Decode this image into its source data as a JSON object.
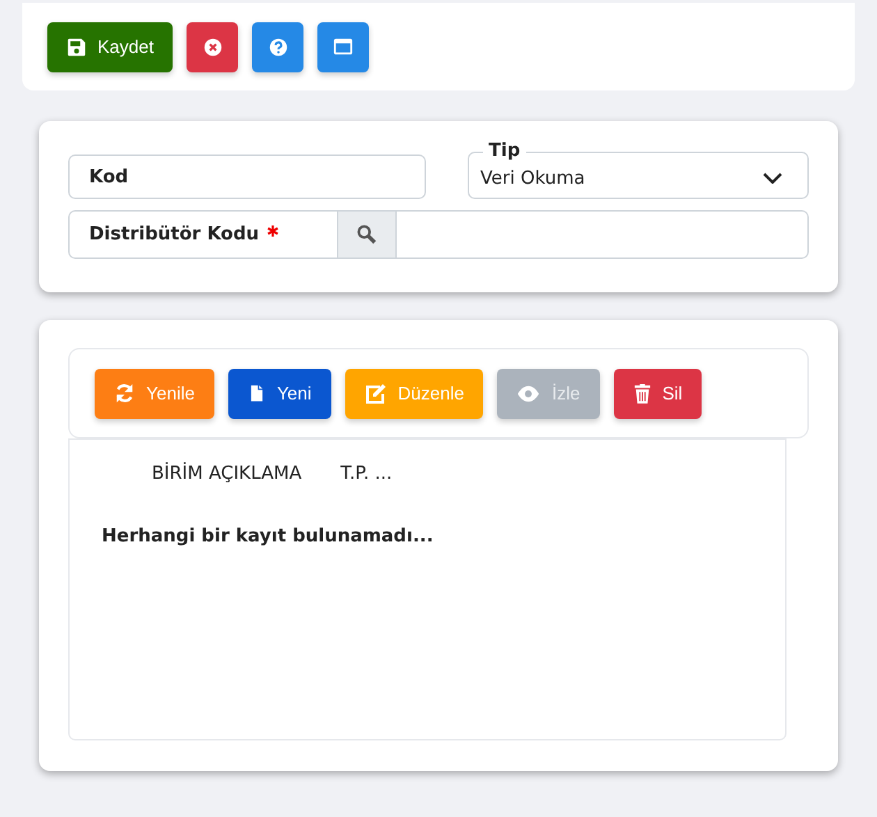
{
  "top_toolbar": [
    {
      "kind": "save",
      "label": "Kaydet",
      "color": "#267300"
    },
    {
      "kind": "close",
      "color": "#dc3545"
    },
    {
      "kind": "help",
      "color": "#2589e6"
    },
    {
      "kind": "window",
      "color": "#2589e6"
    }
  ],
  "form": {
    "kod": {
      "placeholder": "Kod"
    },
    "tip": {
      "legend": "Tip",
      "value": "Veri Okuma"
    },
    "distributor": {
      "label": "Distribütör Kodu",
      "required": true
    }
  },
  "grid_toolbar": [
    {
      "kind": "refresh",
      "label": "Yenile",
      "color": "#fd7e14",
      "disabled": false
    },
    {
      "kind": "new",
      "label": "Yeni",
      "color": "#0b57d0",
      "disabled": false
    },
    {
      "kind": "edit",
      "label": "Düzenle",
      "color": "#ffa500",
      "disabled": false
    },
    {
      "kind": "view",
      "label": "İzle",
      "color": "#abb3bc",
      "disabled": true
    },
    {
      "kind": "delete",
      "label": "Sil",
      "color": "#dc3545",
      "disabled": false
    }
  ],
  "table": {
    "columns": [
      "BİRİM AÇIKLAMA",
      "T.P. ..."
    ],
    "empty_message": "Herhangi bir kayıt bulunamadı..."
  }
}
